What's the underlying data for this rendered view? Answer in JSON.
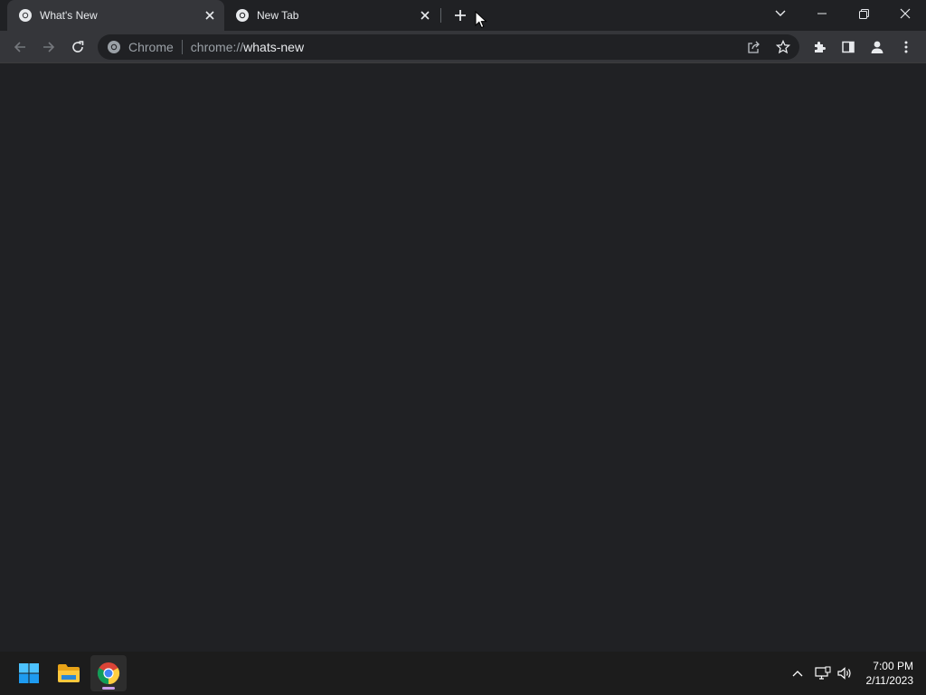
{
  "browser": {
    "tabs": [
      {
        "title": "What's New",
        "active": true
      },
      {
        "title": "New Tab",
        "active": false
      }
    ],
    "omnibox": {
      "chip": "Chrome",
      "url_scheme": "chrome://",
      "url_host": "whats-new"
    }
  },
  "taskbar": {
    "apps": [
      "start-icon",
      "file-explorer-icon",
      "chrome-icon"
    ],
    "clock": {
      "time": "7:00 PM",
      "date": "2/11/2023"
    }
  },
  "colors": {
    "background": "#202124",
    "toolbar": "#35363a",
    "taskbar": "#1c1c1c",
    "accent": "#c89eea"
  }
}
